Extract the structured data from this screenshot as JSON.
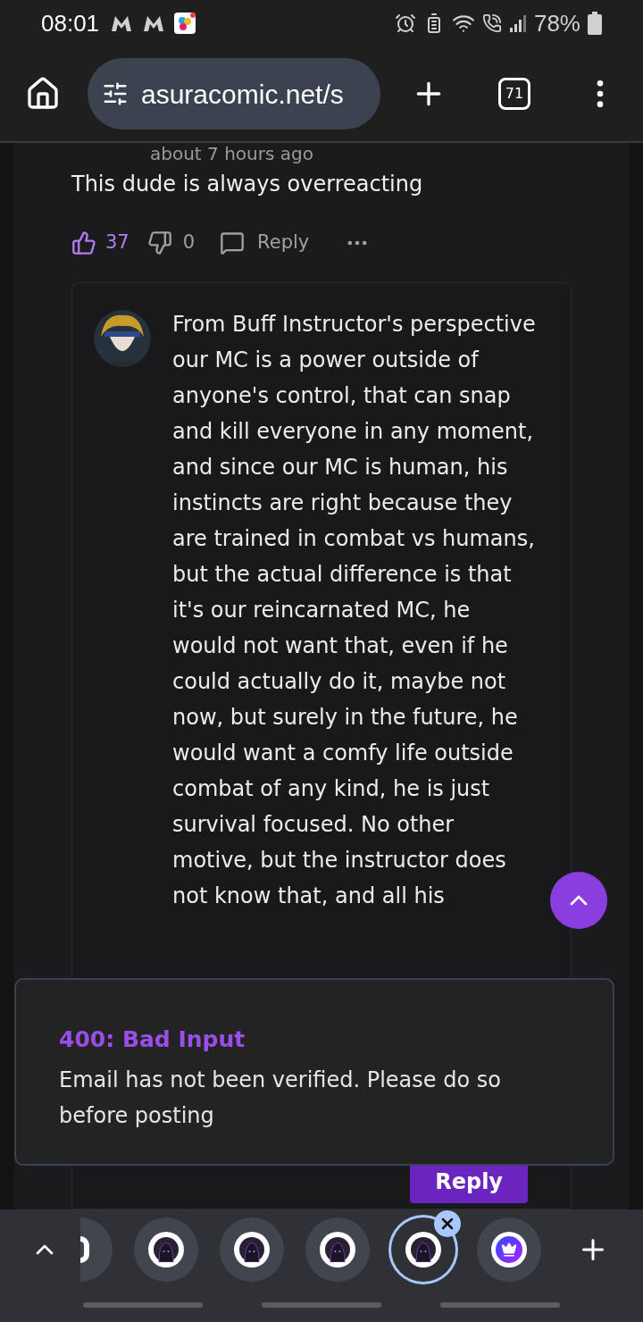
{
  "status_bar": {
    "time": "08:01",
    "battery": "78%"
  },
  "browser": {
    "url": "asuracomic.net/s",
    "tab_count": "71"
  },
  "comment": {
    "time": "about 7 hours ago",
    "text": "This dude is always overreacting",
    "likes": "37",
    "liked": true,
    "dislikes": "0",
    "reply_label": "Reply"
  },
  "reply": {
    "text": "From Buff Instructor's perspective our MC is a power outside of anyone's control, that can snap and kill everyone in any moment, and since our MC is human, his instincts are right because they are trained in combat vs humans, but the actual difference is that it's our reincarnated MC, he would not want that, even if he could actually do it, maybe not now, but surely in the future, he would want a comfy life outside combat of any kind, he is just survival focused. No other motive, but the instructor does not know that, and all his",
    "button": "Reply"
  },
  "toast": {
    "title": "400: Bad Input",
    "message": "Email has not been verified. Please do so before posting"
  },
  "tab_strip": {
    "tabs": [
      {
        "kind": "partial",
        "selected": false
      },
      {
        "kind": "hood",
        "selected": false
      },
      {
        "kind": "hood",
        "selected": false
      },
      {
        "kind": "hood",
        "selected": false
      },
      {
        "kind": "hood",
        "selected": true
      },
      {
        "kind": "crown",
        "selected": false
      }
    ]
  }
}
